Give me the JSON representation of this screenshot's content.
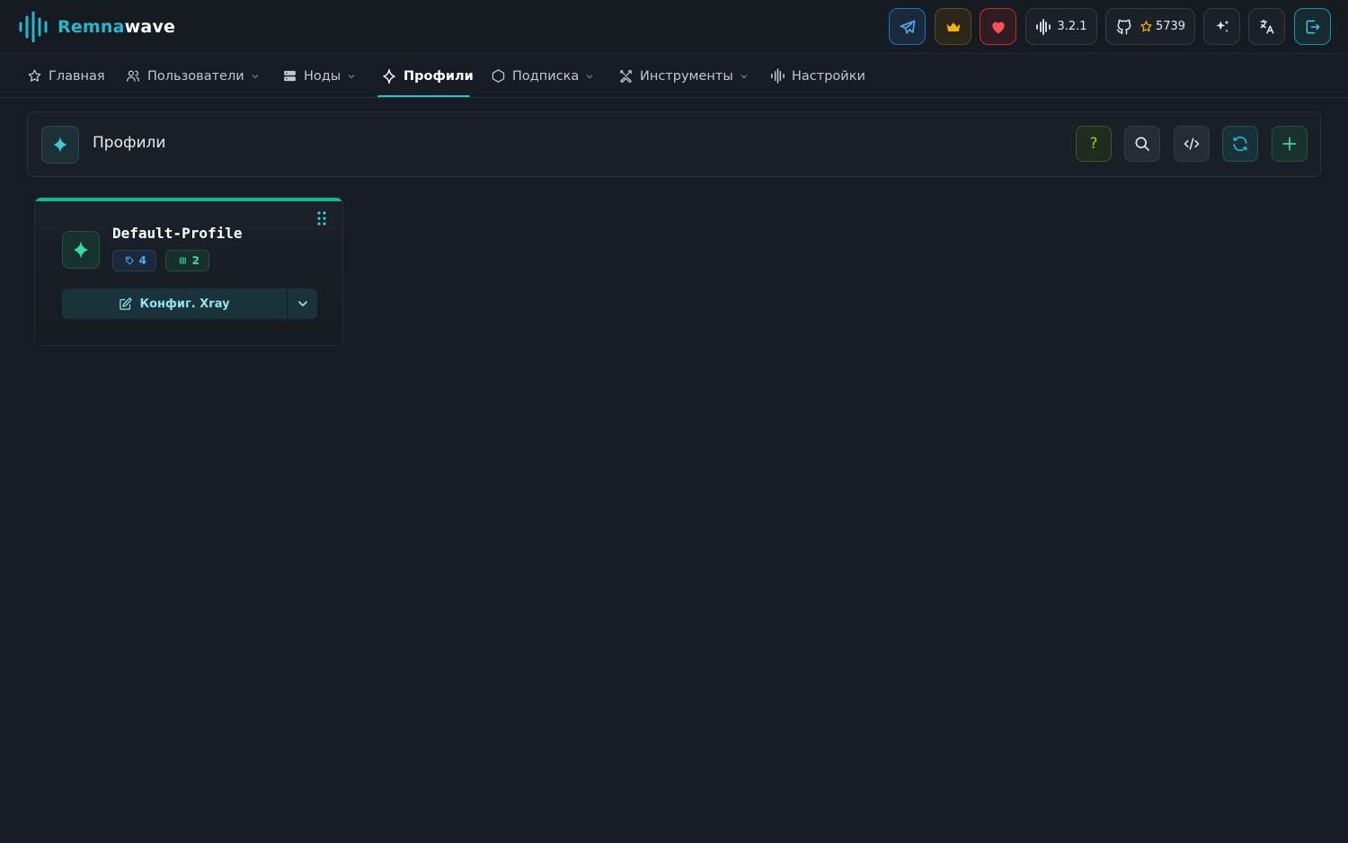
{
  "app": {
    "logo_part1": "Remna",
    "logo_part2": "wave",
    "accent_color": "#22b8cf",
    "brand_icon": "waveform-icon"
  },
  "header": {
    "buttons": [
      {
        "icon": "telegram-icon",
        "label": ""
      },
      {
        "icon": "crown-icon",
        "label": ""
      },
      {
        "icon": "heart-icon",
        "label": ""
      },
      {
        "icon": "waveform-icon",
        "label": "3.2.1"
      },
      {
        "icon": "github-icon",
        "label": "5739",
        "sub_icon": "star-icon"
      },
      {
        "icon": "sparkles-icon",
        "label": ""
      },
      {
        "icon": "translate-icon",
        "label": ""
      },
      {
        "icon": "logout-icon",
        "label": ""
      }
    ]
  },
  "nav": {
    "items": [
      {
        "label": "Главная",
        "icon": "star-icon",
        "has_dropdown": false,
        "active": false
      },
      {
        "label": "Пользователи",
        "icon": "users-icon",
        "has_dropdown": true,
        "active": false
      },
      {
        "label": "Ноды",
        "icon": "server-icon",
        "has_dropdown": true,
        "active": false
      },
      {
        "label": "Профили",
        "icon": "sparkle-icon",
        "has_dropdown": false,
        "active": true
      },
      {
        "label": "Подписка",
        "icon": "hexagon-icon",
        "has_dropdown": true,
        "active": false
      },
      {
        "label": "Инструменты",
        "icon": "tools-icon",
        "has_dropdown": true,
        "active": false
      },
      {
        "label": "Настройки",
        "icon": "waveform-icon",
        "has_dropdown": false,
        "active": false
      }
    ]
  },
  "page": {
    "title": "Профили",
    "actions": [
      {
        "icon": "help-icon",
        "label": "?"
      },
      {
        "icon": "search-icon"
      },
      {
        "icon": "code-icon"
      },
      {
        "icon": "refresh-icon"
      },
      {
        "icon": "plus-icon"
      }
    ]
  },
  "profiles": [
    {
      "name": "Default-Profile",
      "inbounds_count": "4",
      "nodes_count": "2",
      "config_button_label": "Конфиг. Xray",
      "status_color": "#12b886"
    }
  ]
}
